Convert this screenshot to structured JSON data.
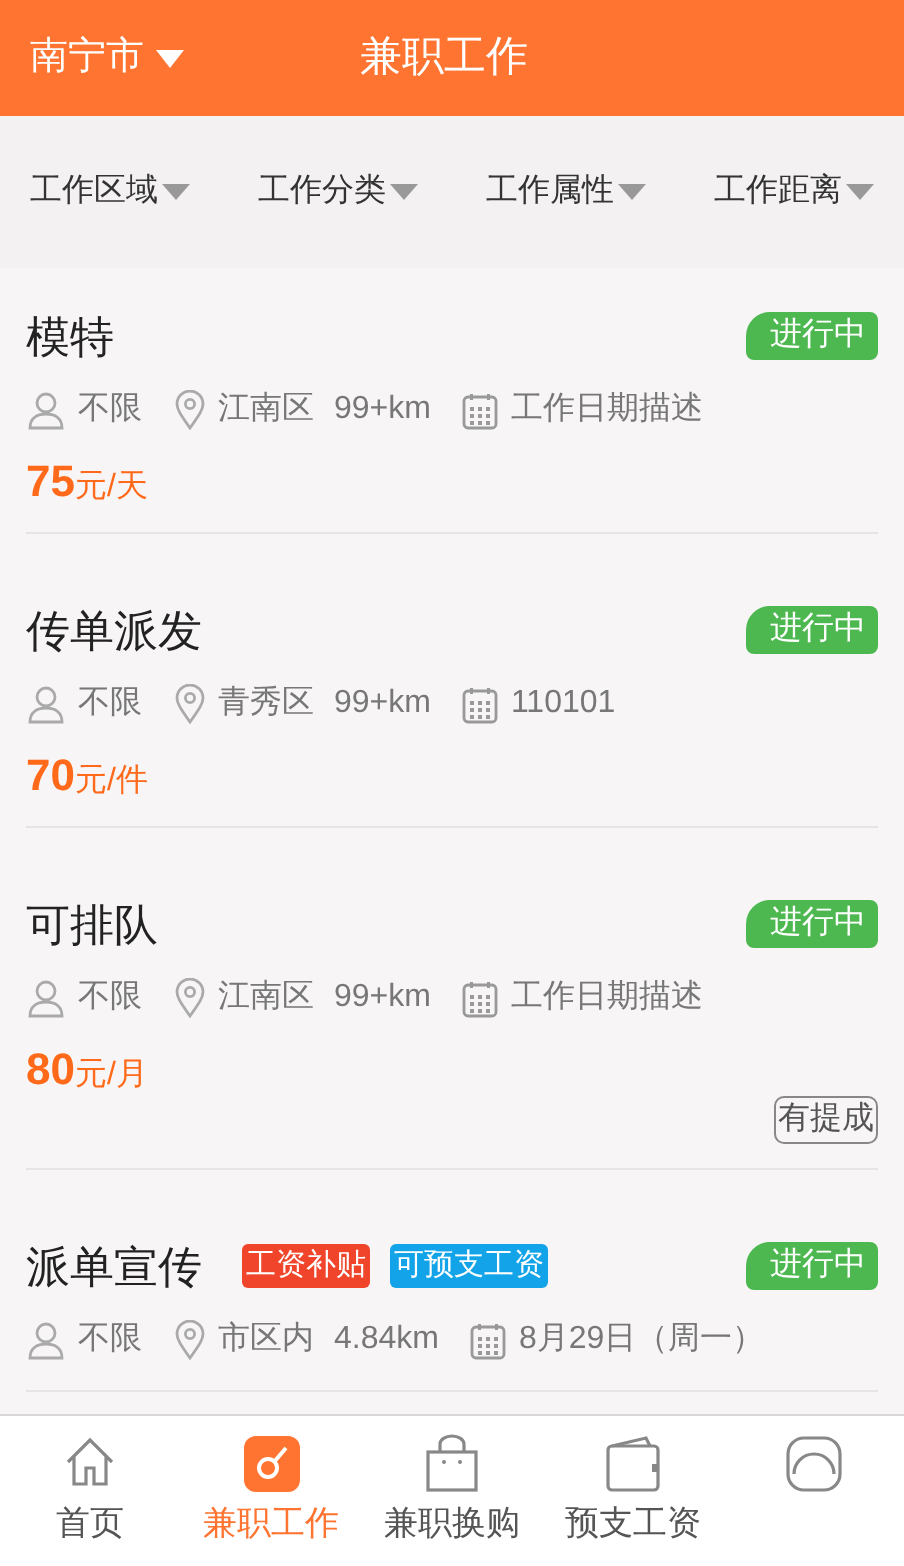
{
  "header": {
    "city": "南宁市",
    "title": "兼职工作"
  },
  "filters": [
    {
      "label": "工作区域"
    },
    {
      "label": "工作分类"
    },
    {
      "label": "工作属性"
    },
    {
      "label": "工作距离"
    }
  ],
  "jobs": [
    {
      "title": "模特",
      "status": "进行中",
      "gender": "不限",
      "area": "江南区",
      "distance": "99+km",
      "date": "工作日期描述",
      "price": "75",
      "unit": "元/天"
    },
    {
      "title": "传单派发",
      "status": "进行中",
      "gender": "不限",
      "area": "青秀区",
      "distance": "99+km",
      "date": "110101",
      "price": "70",
      "unit": "元/件"
    },
    {
      "title": "可排队",
      "status": "进行中",
      "gender": "不限",
      "area": "江南区",
      "distance": "99+km",
      "date": "工作日期描述",
      "price": "80",
      "unit": "元/月",
      "extra": "有提成"
    },
    {
      "title": "派单宣传",
      "tags": [
        {
          "label": "工资补贴",
          "color": "#f0452a"
        },
        {
          "label": "可预支工资",
          "color": "#13a3e8"
        }
      ],
      "status": "进行中",
      "gender": "不限",
      "area": "市区内",
      "distance": "4.84km",
      "date": "8月29日（周一）"
    }
  ],
  "nav": [
    {
      "kind": "home",
      "label": "首页",
      "selected": false
    },
    {
      "kind": "job",
      "label": "兼职工作",
      "selected": true
    },
    {
      "kind": "bag",
      "label": "兼职换购",
      "selected": false
    },
    {
      "kind": "wallet",
      "label": "预支工资",
      "selected": false
    },
    {
      "kind": "profile",
      "selected": false
    }
  ]
}
